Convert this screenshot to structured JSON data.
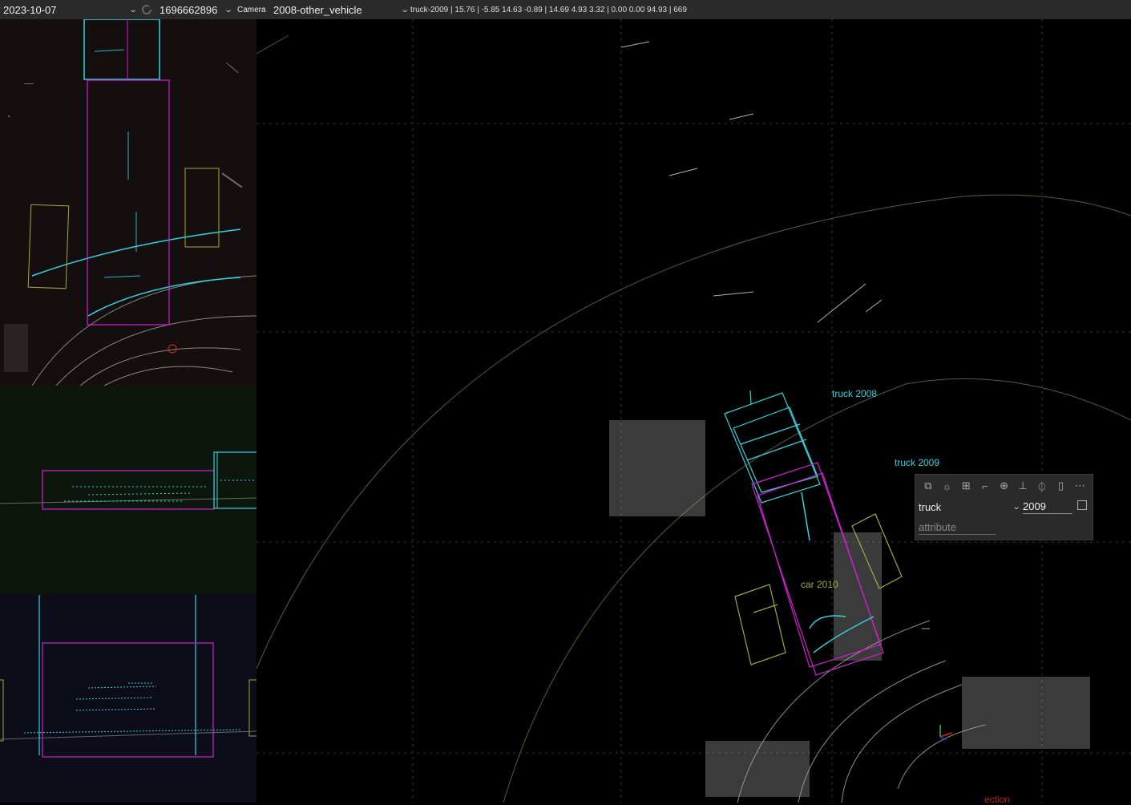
{
  "topbar": {
    "date": "2023-10-07",
    "frame": "1696662896",
    "camera_label": "Camera",
    "object": "2008-other_vehicle",
    "status": "truck-2009 | 15.76 | -5.85 14.63 -0.89 | 14.69 4.93 3.32 | 0.00 0.00 94.93 | 669"
  },
  "labels": {
    "truck_2008": "truck  2008",
    "truck_2009": "truck  2009",
    "car_2010": "car  2010",
    "partial": "ection"
  },
  "panel": {
    "class_value": "truck",
    "id_value": "2009",
    "attribute_placeholder": "attribute",
    "icons": [
      "copy-icon",
      "lightbulb-icon",
      "layout-icon",
      "curve-icon",
      "zoom-in-icon",
      "split-icon",
      "pin-icon",
      "trash-icon",
      "more-icon"
    ]
  },
  "colors": {
    "cyan": "#2fd4e0",
    "magenta": "#d21fd2",
    "olive": "#9cad3a",
    "ring": "#5c5c2c"
  }
}
